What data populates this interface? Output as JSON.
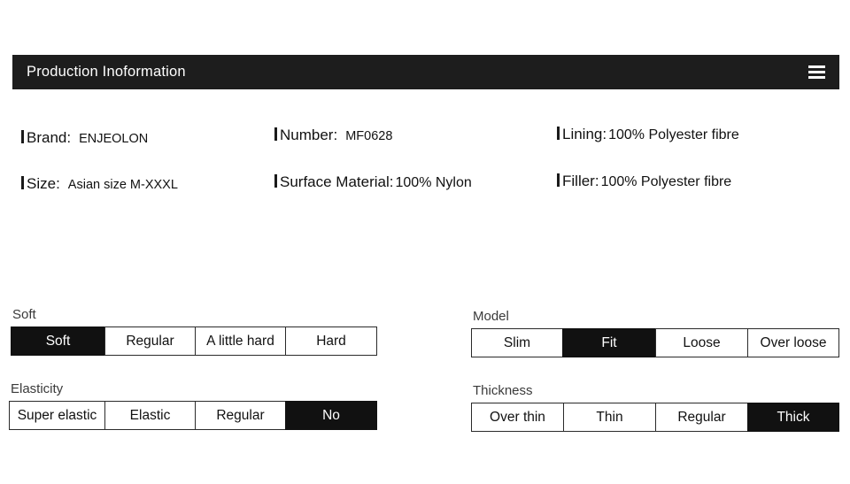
{
  "header": {
    "title": "Production Inoformation",
    "menu_icon": "hamburger-menu-icon"
  },
  "specs": [
    {
      "id": "brand",
      "label": "Brand:",
      "value": "ENJEOLON"
    },
    {
      "id": "size",
      "label": "Size:",
      "value": "Asian size M-XXXL"
    },
    {
      "id": "number",
      "label": "Number:",
      "value": "MF0628"
    },
    {
      "id": "surface",
      "label": "Surface Material:",
      "value": "100% Nylon"
    },
    {
      "id": "lining",
      "label": "Lining:",
      "value": "100% Polyester fibre"
    },
    {
      "id": "filler",
      "label": "Filler:",
      "value": "100% Polyester fibre"
    }
  ],
  "option_groups": [
    {
      "id": "soft",
      "label": "Soft",
      "options": [
        "Soft",
        "Regular",
        "A little hard",
        "Hard"
      ],
      "selected": "Soft"
    },
    {
      "id": "elasticity",
      "label": "Elasticity",
      "options": [
        "Super elastic",
        "Elastic",
        "Regular",
        "No"
      ],
      "selected": "No"
    },
    {
      "id": "model",
      "label": "Model",
      "options": [
        "Slim",
        "Fit",
        "Loose",
        "Over loose"
      ],
      "selected": "Fit"
    },
    {
      "id": "thickness",
      "label": "Thickness",
      "options": [
        "Over thin",
        "Thin",
        "Regular",
        "Thick"
      ],
      "selected": "Thick"
    }
  ],
  "colors": {
    "page_background": "#ffffff",
    "header_background": "#1d1d1d",
    "header_text": "#ffffff",
    "selected_background": "#111111",
    "selected_text": "#ffffff",
    "cell_border": "#2a2a2a",
    "group_label_text": "#3a3a3a",
    "body_text": "#111111"
  }
}
